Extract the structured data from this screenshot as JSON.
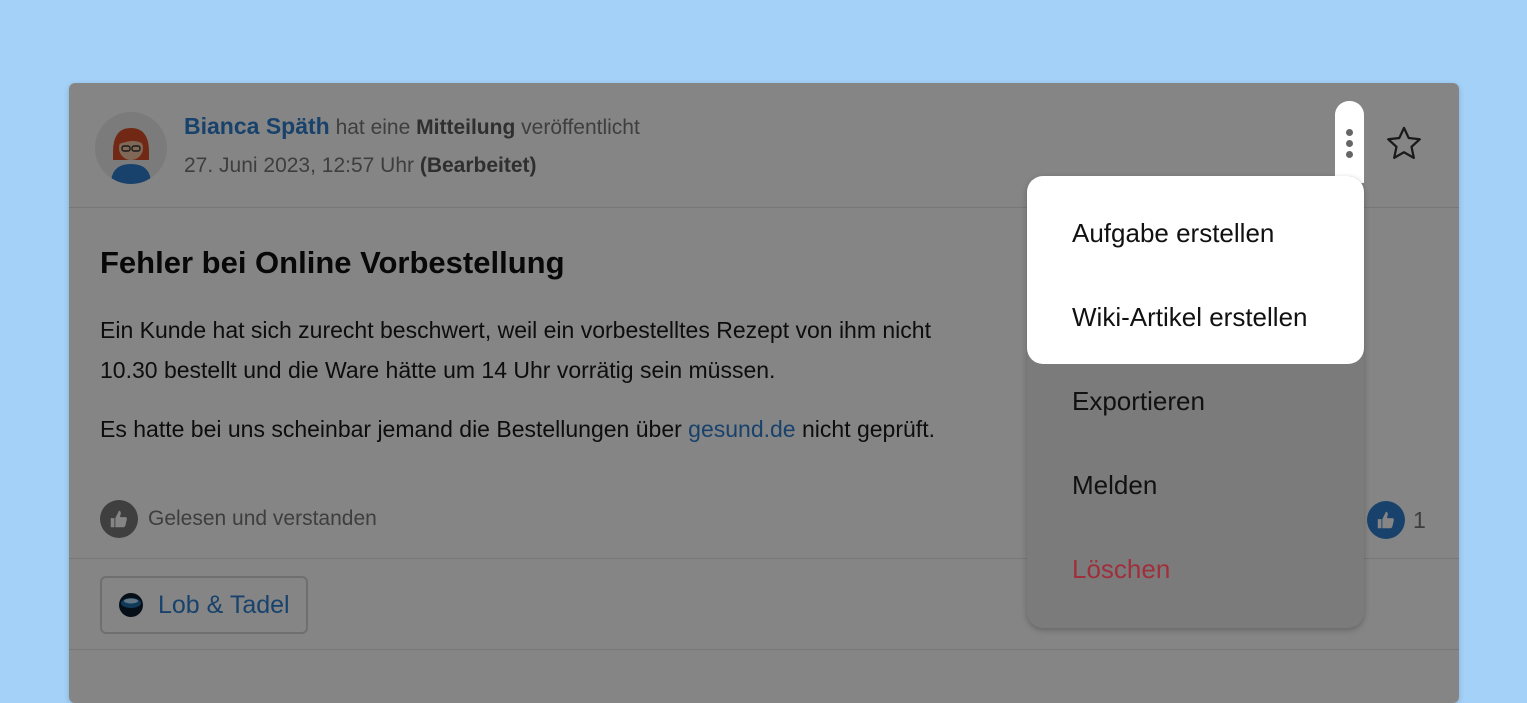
{
  "post": {
    "author": "Bianca Späth",
    "action_pre": "hat eine",
    "action_type": "Mitteilung",
    "action_post": "veröffentlicht",
    "date": "27. Juni 2023, 12:57 Uhr",
    "edited": "(Bearbeitet)",
    "title": "Fehler bei Online Vorbestellung",
    "para1_line1": "Ein Kunde hat sich zurecht beschwert, weil ein vorbestelltes Rezept von ihm nicht",
    "para1_line2": "10.30 bestellt und die Ware hätte um 14 Uhr vorrätig sein müssen.",
    "para2_pre": "Es hatte bei uns scheinbar jemand die Bestellungen über",
    "para2_link": "gesund.de",
    "para2_post": "nicht geprüft.",
    "reaction_label": "Gelesen und verstanden",
    "like_count": "1",
    "tag_label": "Lob & Tadel"
  },
  "menu": {
    "items": [
      {
        "label": "Aufgabe erstellen"
      },
      {
        "label": "Wiki-Artikel erstellen"
      },
      {
        "label": "Exportieren"
      },
      {
        "label": "Melden"
      },
      {
        "label": "Löschen"
      }
    ]
  },
  "icons": {
    "avatar": "user-avatar",
    "star": "star-icon",
    "more": "more-vertical-icon",
    "thumb": "thumbs-up-icon",
    "tag": "globe-icon"
  },
  "colors": {
    "background": "#a3d1f8",
    "accent": "#2f7fd0",
    "danger": "#a02f3c"
  }
}
